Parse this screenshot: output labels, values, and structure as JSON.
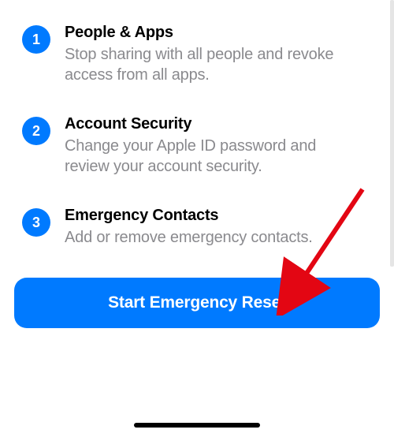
{
  "steps": [
    {
      "number": "1",
      "title": "People & Apps",
      "desc": "Stop sharing with all people and revoke access from all apps."
    },
    {
      "number": "2",
      "title": "Account Security",
      "desc": "Change your Apple ID password and review your account security."
    },
    {
      "number": "3",
      "title": "Emergency Contacts",
      "desc": "Add or remove emergency contacts."
    }
  ],
  "cta": {
    "label": "Start Emergency Reset"
  },
  "colors": {
    "accent": "#007AFF"
  }
}
